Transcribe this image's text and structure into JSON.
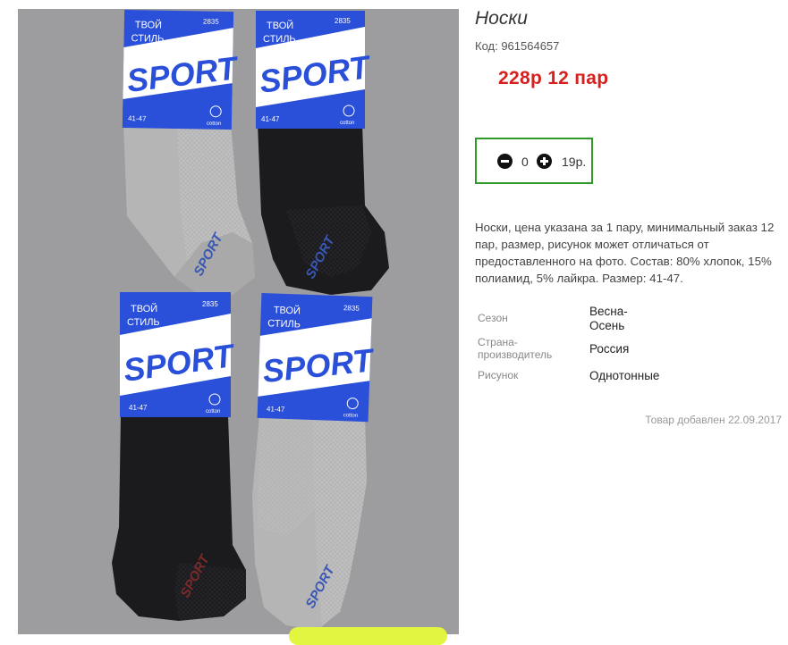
{
  "product": {
    "title": "Носки",
    "sku": "Код: 961564657",
    "price": "228р  12 пар",
    "quantity": "0",
    "unit_price": "19р.",
    "description": "Носки, цена указана за 1 пару, минимальный заказ 12 пар, размер, рисунок может отличаться от предоставленного на фото. Состав: 80% хлопок, 15% полиамид, 5% лайкра. Размер: 41-47.",
    "attributes": [
      {
        "label": "Сезон",
        "value": "Весна-Осень"
      },
      {
        "label": "Страна-производитель",
        "value": "Россия"
      },
      {
        "label": "Рисунок",
        "value": "Однотонные"
      }
    ],
    "added": "Товар добавлен 22.09.2017"
  },
  "photo": {
    "label_top": "ТВОЙ",
    "label_mid": "СТИЛЬ",
    "label_code": "2835",
    "label_brand": "SPORT",
    "label_size": "41-47",
    "label_cotton": "cotton",
    "sole_text": "SPORT"
  },
  "colors": {
    "price": "#d62020",
    "qty_border": "#2f9a2a",
    "photo_bg": "#9d9c9e",
    "label_blue": "#2a4fd8",
    "sock_grey": "#b5b5b5",
    "sock_black": "#1b1b1e",
    "cart_button": "#e2f640"
  },
  "icons": {
    "minus": "minus-circle-icon",
    "plus": "plus-circle-icon",
    "cotton": "cotton-flower-icon"
  }
}
